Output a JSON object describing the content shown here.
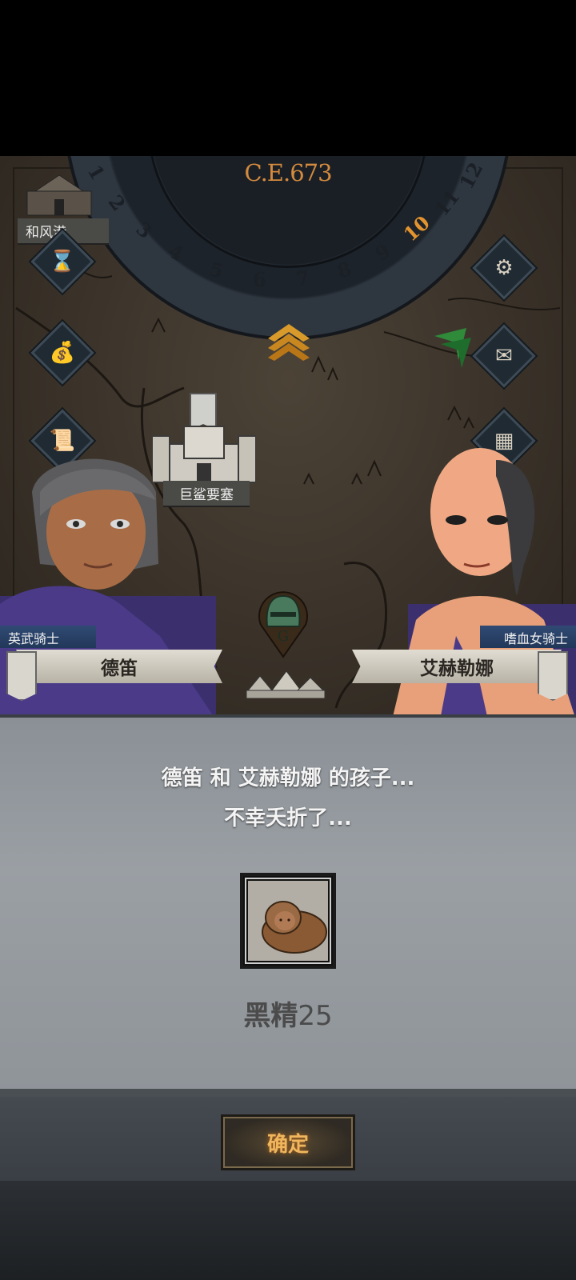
{
  "calendar": {
    "year": "C.E.673",
    "months": [
      "1",
      "2",
      "3",
      "4",
      "5",
      "6",
      "7",
      "8",
      "9",
      "10",
      "11",
      "12"
    ],
    "current_month": "10"
  },
  "map": {
    "places": {
      "harbor": "和风港",
      "fortress": "巨鲨要塞"
    },
    "icons": {
      "hourglass": "hourglass-icon",
      "bag": "money-bag-icon",
      "scroll": "scroll-icon",
      "settings": "gear-icon",
      "mail": "mail-icon",
      "menu": "window-icon"
    }
  },
  "characters": {
    "left": {
      "title": "英武骑士",
      "name": "德笛"
    },
    "right": {
      "title": "嗜血女骑士",
      "name": "艾赫勒娜"
    }
  },
  "dialog": {
    "line1": "德笛 和 艾赫勒娜 的孩子...",
    "line2": "不幸夭折了...",
    "child_name": "黑精",
    "child_number": "25",
    "confirm_label": "确定"
  },
  "colors": {
    "accent_gold": "#e3942e",
    "panel_grey": "#9a9fa4",
    "title_blue": "#2c4670"
  }
}
